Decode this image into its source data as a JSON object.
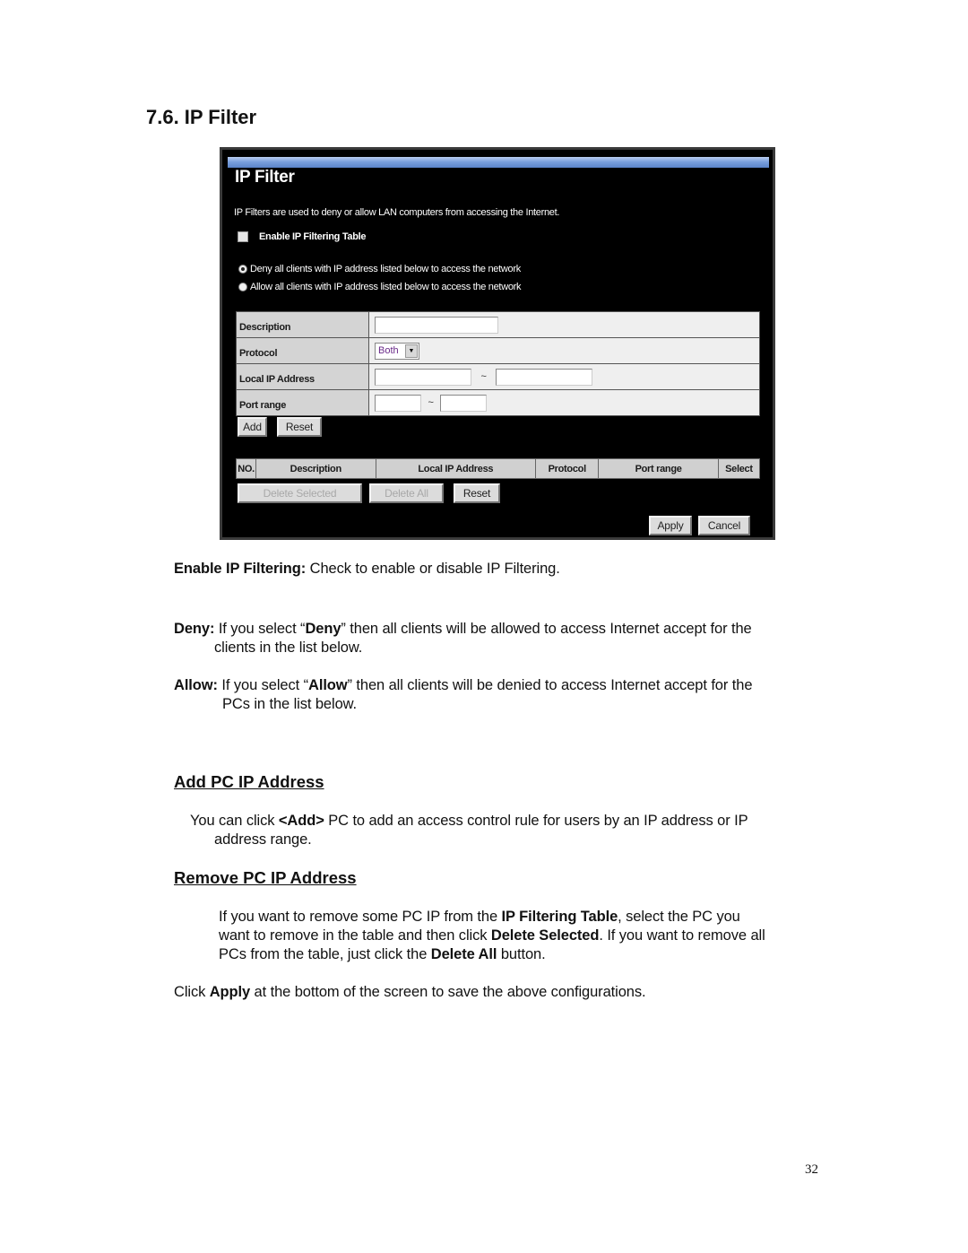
{
  "section": {
    "number": "7.6.",
    "title": "IP Filter",
    "heading": "7.6. IP Filter"
  },
  "figure": {
    "title": "IP Filter",
    "intro": "IP Filters are used to deny or allow LAN computers from accessing the Internet.",
    "enable_checkbox": {
      "label": "Enable IP Filtering Table",
      "checked": false
    },
    "radios": [
      {
        "label": "Deny all clients with IP address listed below to access the network",
        "selected": true
      },
      {
        "label": "Allow all clients with IP address listed below to access the network",
        "selected": false
      }
    ],
    "form": {
      "description_label": "Description",
      "description_value": "",
      "protocol_label": "Protocol",
      "protocol_value": "Both",
      "local_ip_label": "Local IP Address",
      "local_ip_start": "",
      "local_ip_end": "",
      "port_range_label": "Port range",
      "port_start": "",
      "port_end": "",
      "range_separator": "~"
    },
    "buttons": {
      "add": "Add",
      "reset": "Reset",
      "delete_selected": "Delete Selected",
      "delete_all": "Delete All",
      "list_reset": "Reset",
      "apply": "Apply",
      "cancel": "Cancel"
    },
    "list_columns": [
      "NO.",
      "Description",
      "Local IP Address",
      "Protocol",
      "Port range",
      "Select"
    ]
  },
  "doc": {
    "enable": {
      "term": "Enable IP Filtering:",
      "text": " Check to enable or disable IP Filtering."
    },
    "deny": {
      "term": "Deny:",
      "pre": " If you select “",
      "bold": "Deny",
      "post": "” then all clients will be allowed to access Internet accept for the",
      "line2": "clients in the list below."
    },
    "allow": {
      "term": "Allow:",
      "pre": " If you select “",
      "bold": "Allow",
      "post": "” then all clients will be denied to access Internet accept for the",
      "line2": "PCs in the list below."
    },
    "add_heading": "Add PC IP Address",
    "add_text": {
      "pre": "You can click ",
      "bold": "<Add>",
      "post": " PC to add an access control rule for users by an IP address or IP",
      "line2": "address range."
    },
    "remove_heading": "Remove PC IP Address",
    "remove_text": {
      "l1_pre": "If you want to remove some PC IP from the ",
      "l1_bold": "IP Filtering Table",
      "l1_post": ", select the PC you",
      "l2_pre": "want to remove in the table and then click ",
      "l2_bold": "Delete Selected",
      "l2_post": ". If you want to remove all",
      "l3_pre": "PCs from the table, just click the ",
      "l3_bold": "Delete All",
      "l3_post": " button."
    },
    "apply_text": {
      "pre": "Click ",
      "bold": "Apply",
      "post": " at the bottom of the screen to save the above configurations."
    }
  },
  "page_number": "32"
}
